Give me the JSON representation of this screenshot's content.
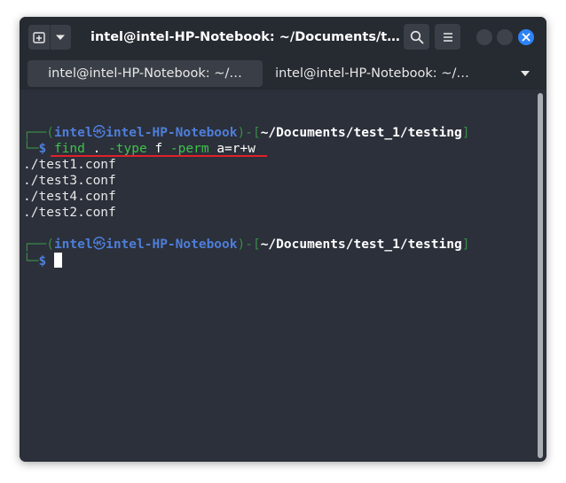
{
  "window": {
    "title": "intel@intel-HP-Notebook: ~/Documents/tes…",
    "colors": {
      "titlebar": "#262a31",
      "terminal_bg": "#2b303a",
      "close": "#2f83f7",
      "accent_underline": "#e0202a"
    },
    "icons": {
      "new_tab": "new-tab-icon",
      "dropdown": "chevron-down-icon",
      "search": "search-icon",
      "menu": "hamburger-menu-icon",
      "close": "close-icon"
    }
  },
  "tabs": [
    {
      "label": "intel@intel-HP-Notebook: ~/…",
      "active": true
    },
    {
      "label": "intel@intel-HP-Notebook: ~/…",
      "active": false
    }
  ],
  "terminal": {
    "prompt": {
      "tree_top": "┌──",
      "tree_bottom": "└─",
      "open_paren": "(",
      "user": "intel",
      "skull": "㉿",
      "host": "intel-HP-Notebook",
      "close_paren": ")",
      "dash": "-",
      "open_bracket": "[",
      "path": "~/Documents/test_1/testing",
      "close_bracket": "]",
      "dollar": "$"
    },
    "command": {
      "name": "find",
      "arg_dot": ".",
      "opt_type": "-type",
      "type_val": "f",
      "opt_perm": "-perm",
      "perm_val": "a=r+w"
    },
    "output": [
      "./test1.conf",
      "./test3.conf",
      "./test4.conf",
      "./test2.conf"
    ]
  }
}
